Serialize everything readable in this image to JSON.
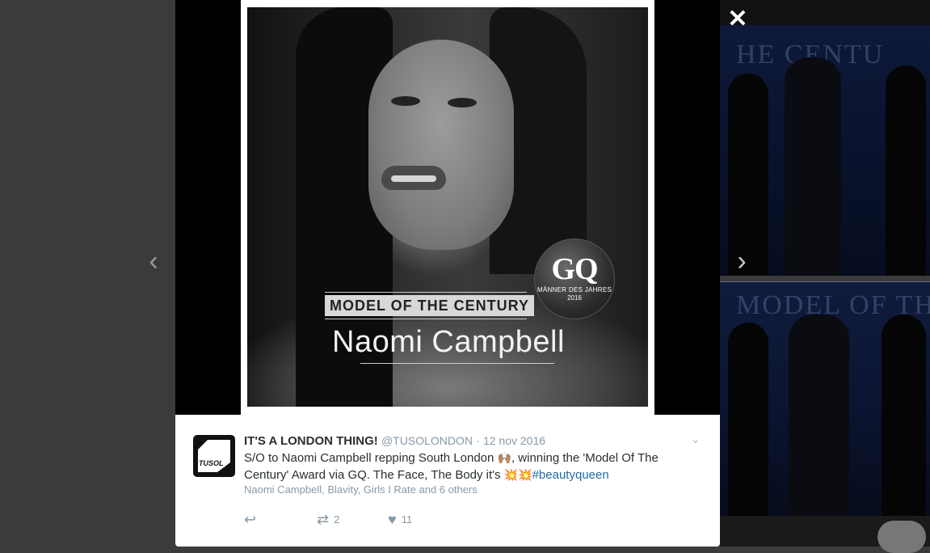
{
  "lightbox": {
    "close_icon": "close-icon",
    "prev_icon": "chevron-left-icon",
    "next_icon": "chevron-right-icon"
  },
  "background": {
    "top_headline": "HE CENTU",
    "bottom_headline": "MODEL OF THE CENTU"
  },
  "image": {
    "badge_logo": "GQ",
    "badge_subtitle": "MÄNNER DES JAHRES",
    "badge_year": "2016",
    "award_title": "MODEL OF THE CENTURY",
    "award_name": "Naomi Campbell"
  },
  "tweet": {
    "avatar_label": "TUSOL",
    "name": "IT'S A LONDON THING!",
    "handle": "@TUSOLONDON",
    "separator": "·",
    "date": "12 nov 2016",
    "text_part1": "S/O to Naomi Campbell repping South London ",
    "emoji_hands": "🙌🏽",
    "text_part2": ", winning the 'Model Of The Century' Award  via GQ. The Face, The Body it's ",
    "emoji_collision": "💥💥",
    "hashtag": "#beautyqueen",
    "tagged": "Naomi Campbell, Blavity, Girls I Rate and 6 others",
    "reply_icon": "reply-icon",
    "retweet_icon": "retweet-icon",
    "retweet_count": "2",
    "like_icon": "heart-icon",
    "like_count": "11",
    "more_icon": "chevron-down-icon"
  },
  "colors": {
    "overlay": "#3b3b3b",
    "hashtag": "#1b6aa5",
    "muted": "#8899a6",
    "text": "#292f33"
  }
}
